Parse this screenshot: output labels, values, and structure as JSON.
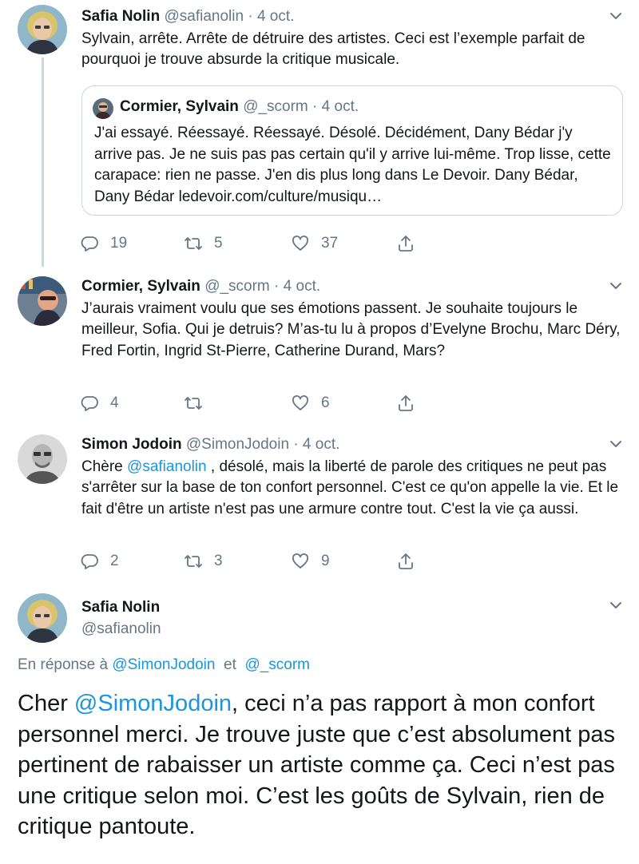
{
  "tweets": [
    {
      "name": "Safia Nolin",
      "handle": "@safianolin",
      "sep": "·",
      "date": "4 oct.",
      "text": "Sylvain, arrête. Arrête de détruire des artistes. Ceci est l’exemple parfait de pourquoi je trouve absurde la critique musicale.",
      "quote": {
        "name": "Cormier, Sylvain",
        "handle": "@_scorm",
        "sep": "·",
        "date": "4 oct.",
        "text": "J'ai essayé. Réessayé. Réessayé. Désolé. Décidément, Dany Bédar j'y arrive pas. Je ne suis pas pas certain qu'il y arrive lui-même. Trop lisse, cette carapace: rien ne passe. J'en dis plus long dans Le Devoir.  Dany Bédar, Dany Bédar ledevoir.com/culture/musiqu…"
      },
      "replies": "19",
      "retweets": "5",
      "likes": "37"
    },
    {
      "name": "Cormier, Sylvain",
      "handle": "@_scorm",
      "sep": "·",
      "date": "4 oct.",
      "text": "J’aurais vraiment voulu que ses émotions passent. Je souhaite toujours le meilleur, Sofia. Qui je detruis? M’as-tu lu à propos d’Evelyne Brochu, Marc Déry, Fred Fortin, Ingrid St-Pierre, Catherine Durand, Mars?",
      "replies": "4",
      "retweets": "",
      "likes": "6"
    },
    {
      "name": "Simon Jodoin",
      "handle": "@SimonJodoin",
      "sep": "·",
      "date": "4 oct.",
      "text_pre": "Chère ",
      "text_mention": "@safianolin",
      "text_post": " , désolé, mais la liberté de parole des critiques ne peut pas s'arrêter sur la base de ton confort personnel. C'est ce qu'on appelle la vie. Et le fait d'être un artiste n'est pas une armure contre tout.  C'est la vie ça aussi.",
      "replies": "2",
      "retweets": "3",
      "likes": "9"
    }
  ],
  "main": {
    "name": "Safia Nolin",
    "handle": "@safianolin",
    "reply_prefix": "En réponse à",
    "reply_to_1": "@SimonJodoin",
    "reply_and": "et",
    "reply_to_2": "@_scorm",
    "text_pre": "Cher ",
    "text_mention": "@SimonJodoin",
    "text_post": ", ceci n’a pas rapport à mon confort personnel merci. Je trouve juste que c’est absolument pas pertinent de rabaisser un artiste comme ça. Ceci n’est pas une critique selon moi. C’est les goûts de Sylvain, rien de critique pantoute."
  },
  "icons": {
    "reply": "reply-icon",
    "retweet": "retweet-icon",
    "like": "heart-icon",
    "share": "share-icon",
    "more": "chevron-down-icon"
  },
  "colors": {
    "text": "#14171a",
    "secondary": "#657786",
    "link": "#1b95e0",
    "border": "#ccd6dd"
  }
}
